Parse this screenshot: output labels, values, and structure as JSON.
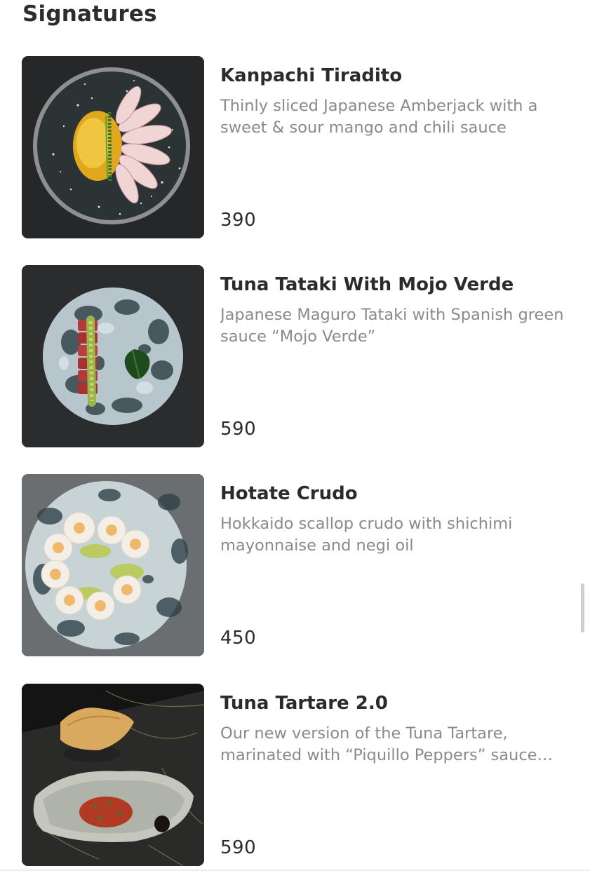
{
  "section": {
    "title": "Signatures"
  },
  "items": [
    {
      "name": "Kanpachi Tiradito",
      "description": "Thinly sliced Japanese Amberjack with a sweet & sour mango and chili sauce",
      "price": "390"
    },
    {
      "name": "Tuna Tataki With Mojo Verde",
      "description": "Japanese Maguro Tataki with Spanish green sauce “Mojo Verde”",
      "price": "590"
    },
    {
      "name": "Hotate Crudo",
      "description": "Hokkaido scallop crudo with shichimi mayonnaise and negi oil",
      "price": "450"
    },
    {
      "name": "Tuna Tartare 2.0",
      "description": "Our new version of the Tuna Tartare, marinated with “Piquillo Peppers” sauce…",
      "price": "590"
    }
  ],
  "colors": {
    "background": "#ffffff",
    "title_text": "#2d2d2d",
    "description_text": "#8a8a8a",
    "scrollbar": "#cfcfcf"
  }
}
